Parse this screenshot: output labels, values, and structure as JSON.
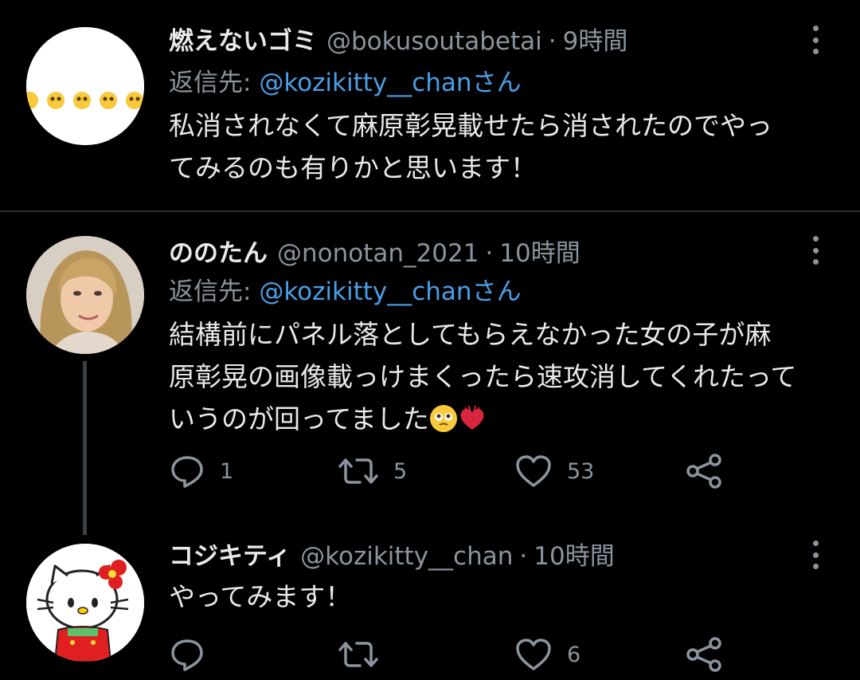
{
  "tweets": [
    {
      "name": "燃えないゴミ",
      "handle": "@bokusoutabetai",
      "separator": "·",
      "time": "9時間",
      "reply_prefix": "返信先:",
      "reply_mention": "@kozikitty__chan",
      "reply_suffix": "さん",
      "text_line1": "私消されなくて麻原彰晃載せたら消されたのでやっ",
      "text_line2": "てみるのも有りかと思います！"
    },
    {
      "name": "ののたん",
      "handle": "@nonotan_2021",
      "separator": "·",
      "time": "10時間",
      "reply_prefix": "返信先:",
      "reply_mention": "@kozikitty__chan",
      "reply_suffix": "さん",
      "text_line1": "結構前にパネル落としてもらえなかった女の子が麻",
      "text_line2": "原彰晃の画像載っけまくったら速攻消してくれたって",
      "text_line3": "いうのが回ってました",
      "replies": "1",
      "retweets": "5",
      "likes": "53"
    },
    {
      "name": "コジキティ",
      "handle": "@kozikitty__chan",
      "separator": "·",
      "time": "10時間",
      "text_line1": "やってみます！",
      "replies": "",
      "retweets": "",
      "likes": "6"
    }
  ],
  "colors": {
    "background": "#000000",
    "text": "#e7e9ea",
    "muted": "#8b949e",
    "mention": "#4a9fe6"
  },
  "icons": {
    "more": "more-vertical-icon",
    "reply": "reply-bubble-icon",
    "retweet": "retweet-icon",
    "like": "heart-icon",
    "share": "share-icon"
  }
}
